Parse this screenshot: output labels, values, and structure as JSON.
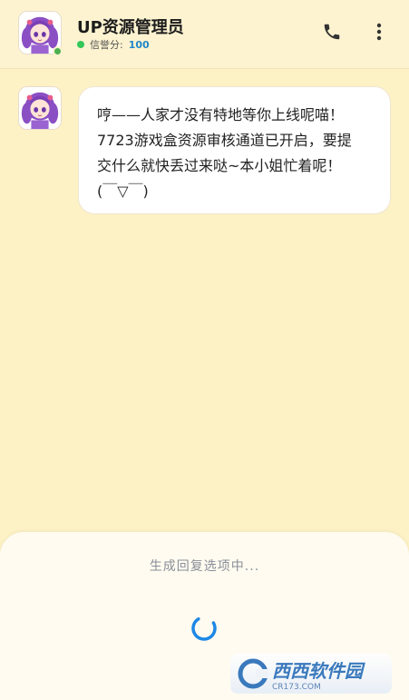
{
  "header": {
    "title": "UP资源管理员",
    "reputation_label": "信誉分:",
    "reputation_value": "100",
    "phone_icon": "phone-icon",
    "more_icon": "more-vertical-icon"
  },
  "message": {
    "lines": [
      "哼——人家才没有特地等你上线呢喵！",
      "7723游戏盒资源审核通道已开启，要提",
      "交什么就快丢过来哒~本小姐忙着呢！",
      "(￣▽￣)"
    ]
  },
  "panel": {
    "status": "生成回复选项中..."
  },
  "watermark": {
    "main": "西西软件园",
    "sub": "CR173.COM"
  },
  "colors": {
    "background": "#fdf1c6",
    "accent_blue": "#1e88c9",
    "online_green": "#34c759"
  }
}
